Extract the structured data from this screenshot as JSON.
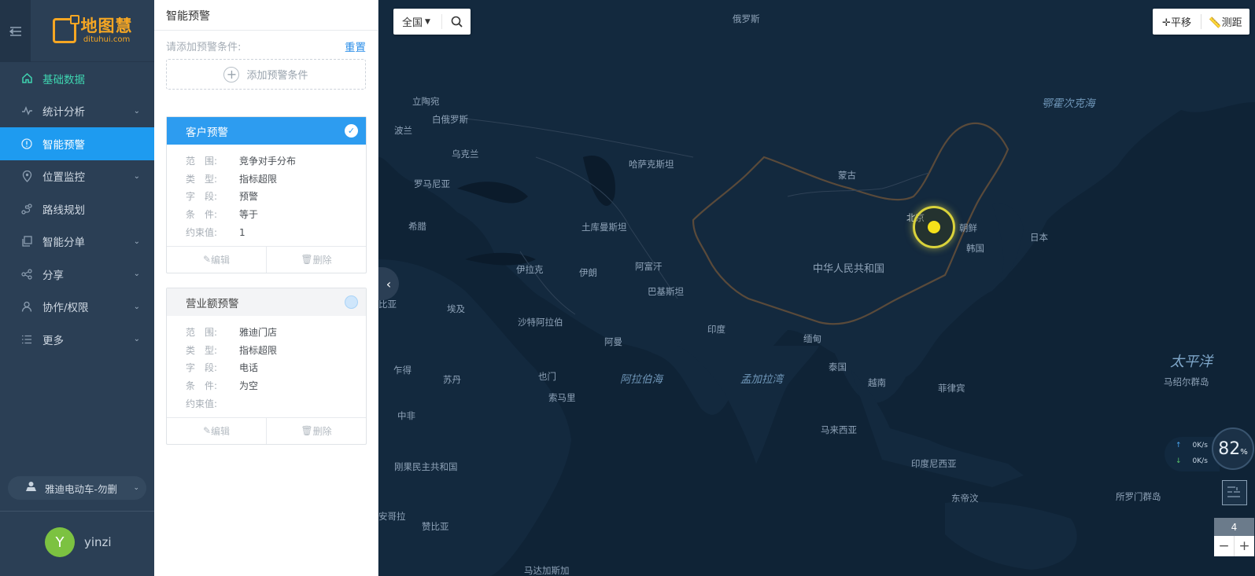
{
  "sidebar": {
    "logo_cn": "地图慧",
    "logo_en": "dituhui.com",
    "menu": [
      {
        "label": "基础数据",
        "icon": "home-icon"
      },
      {
        "label": "统计分析",
        "icon": "chart-line-icon"
      },
      {
        "label": "智能预警",
        "icon": "alert-circle-icon"
      },
      {
        "label": "位置监控",
        "icon": "location-pin-icon"
      },
      {
        "label": "路线规划",
        "icon": "route-icon"
      },
      {
        "label": "智能分单",
        "icon": "copy-icon"
      },
      {
        "label": "分享",
        "icon": "share-icon"
      },
      {
        "label": "协作/权限",
        "icon": "user-icon"
      },
      {
        "label": "更多",
        "icon": "list-icon"
      }
    ],
    "org": "雅迪电动车-勿删",
    "user": {
      "initial": "Y",
      "name": "yinzi"
    }
  },
  "panel": {
    "title": "智能预警",
    "cond_hint": "请添加预警条件:",
    "reset": "重置",
    "add_condition": "添加预警条件",
    "field_labels": {
      "range": "范　围:",
      "type": "类　型:",
      "field": "字　段:",
      "cond": "条　件:",
      "limit": "约束值:"
    },
    "edit": "编辑",
    "delete": "删除",
    "cards": [
      {
        "title": "客户预警",
        "checked": true,
        "range": "竞争对手分布",
        "type": "指标超限",
        "field": "预警",
        "cond": "等于",
        "limit": "1"
      },
      {
        "title": "营业额预警",
        "checked": false,
        "range": "雅迪门店",
        "type": "指标超限",
        "field": "电话",
        "cond": "为空",
        "limit": ""
      }
    ]
  },
  "map": {
    "region": "全国",
    "tools": {
      "pan": "平移",
      "measure": "测距"
    },
    "labels": {
      "russia": "俄罗斯",
      "okhotsk": "鄂霍次克海",
      "lithuania": "立陶宛",
      "belarus": "白俄罗斯",
      "poland": "波兰",
      "ukraine": "乌克兰",
      "romania": "罗马尼亚",
      "kazakhstan": "哈萨克斯坦",
      "mongolia": "蒙古",
      "beijing": "北京",
      "korea_n": "朝鲜",
      "korea_s": "韩国",
      "japan": "日本",
      "greece": "希腊",
      "turkmenistan": "土库曼斯坦",
      "china": "中华人民共和国",
      "iraq": "伊拉克",
      "iran": "伊朗",
      "afghanistan": "阿富汗",
      "pakistan": "巴基斯坦",
      "libya": "比亚",
      "egypt": "埃及",
      "saudi": "沙特阿拉伯",
      "india": "印度",
      "myanmar": "缅甸",
      "oman": "阿曼",
      "chad": "乍得",
      "sudan": "苏丹",
      "yemen": "也门",
      "arabian_sea": "阿拉伯海",
      "bay_bengal": "孟加拉湾",
      "thailand": "泰国",
      "vietnam": "越南",
      "philippines": "菲律宾",
      "pacific": "太平洋",
      "marshall": "马绍尔群岛",
      "somalia": "索马里",
      "car": "中非",
      "malaysia": "马来西亚",
      "indonesia": "印度尼西亚",
      "congo": "刚果民主共和国",
      "east_timor": "东帝汶",
      "solomon": "所罗门群岛",
      "angola": "安哥拉",
      "zambia": "赞比亚",
      "madagascar": "马达加斯加"
    },
    "net": {
      "up": "0K/s",
      "down": "0K/s",
      "percent": "82",
      "percent_unit": "%"
    },
    "zoom": "4"
  },
  "colors": {
    "sidebar": "#2b3f55",
    "accent": "#1e9bf0",
    "home": "#3fd4b0",
    "logo": "#f5a623",
    "map_bg": "#0f2336"
  }
}
